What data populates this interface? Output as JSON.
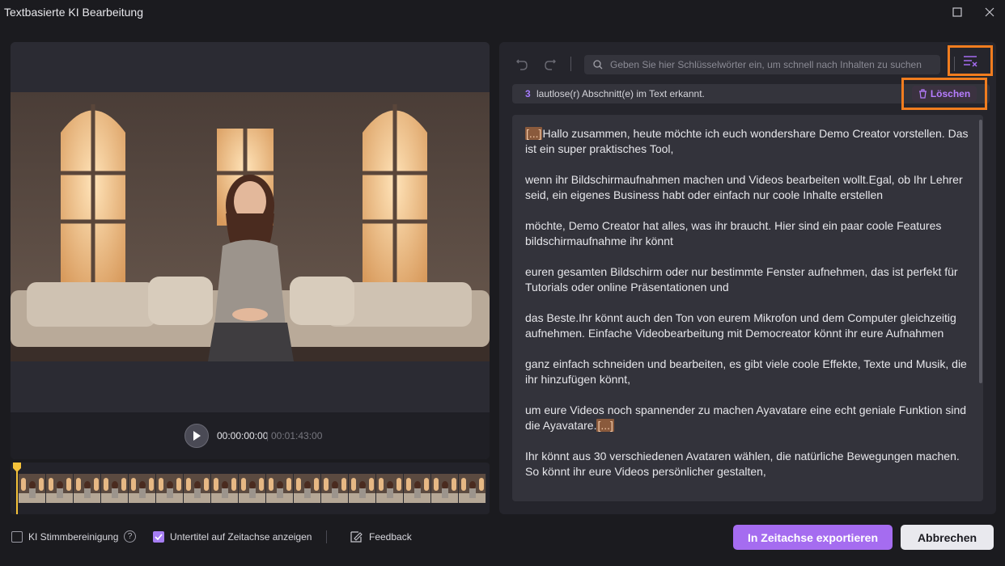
{
  "window": {
    "title": "Textbasierte KI Bearbeitung"
  },
  "player": {
    "current_time": "00:00:00:00",
    "separator": "|",
    "total_time": "00:01:43:00"
  },
  "timeline": {
    "thumbnail_count": 17
  },
  "search": {
    "placeholder": "Geben Sie hier Schlüsselwörter ein, um schnell nach Inhalten zu suchen"
  },
  "info": {
    "count": "3",
    "text": "lautlose(r) Abschnitt(e) im Text erkannt.",
    "delete_label": "Löschen"
  },
  "transcript": {
    "silent_marker": "[...]",
    "p1": "Hallo zusammen, heute möchte ich euch wondershare Demo Creator vorstellen. Das ist ein super praktisches Tool,",
    "p2": " wenn ihr Bildschirmaufnahmen machen und Videos bearbeiten wollt.Egal, ob Ihr Lehrer seid, ein eigenes Business habt oder einfach nur coole Inhalte erstellen",
    "p3": " möchte, Demo Creator hat alles, was ihr braucht. Hier sind ein paar coole Features bildschirmaufnahme ihr könnt",
    "p4": " euren gesamten Bildschirm oder nur bestimmte Fenster aufnehmen, das ist perfekt für Tutorials oder online Präsentationen und",
    "p5": " das Beste.Ihr könnt auch den Ton von eurem Mikrofon und dem Computer gleichzeitig aufnehmen. Einfache Videobearbeitung mit Democreator könnt ihr eure Aufnahmen",
    "p6": " ganz einfach schneiden und bearbeiten, es gibt viele coole Effekte, Texte und Musik, die ihr hinzufügen könnt,",
    "p7": " um eure Videos noch spannender zu machen Ayavatare eine echt geniale Funktion sind die Ayavatare.",
    "p8": "Ihr könnt aus 30 verschiedenen Avataren wählen, die natürliche Bewegungen machen. So könnt ihr eure Videos persönlicher gestalten,"
  },
  "footer": {
    "voice_cleanup_label": "KI Stimmbereinigung",
    "voice_cleanup_checked": false,
    "subtitles_label": "Untertitel auf Zeitachse anzeigen",
    "subtitles_checked": true,
    "feedback_label": "Feedback",
    "export_label": "In Zeitachse exportieren",
    "cancel_label": "Abbrechen"
  },
  "colors": {
    "accent": "#a56cf0",
    "highlight_border": "#f17d1f",
    "silent_marker_bg": "#8a5a3c"
  }
}
